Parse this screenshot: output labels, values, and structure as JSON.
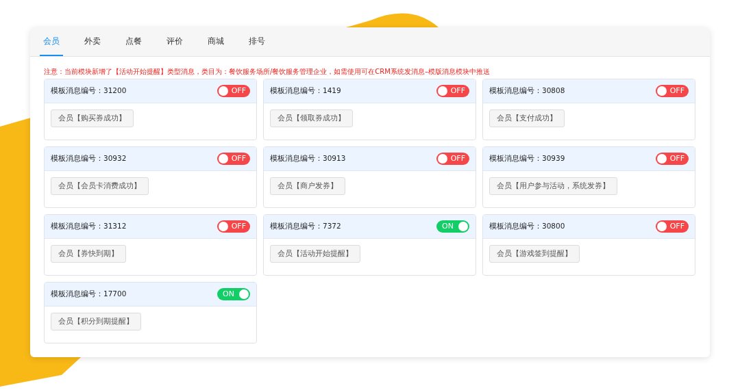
{
  "tabs": [
    {
      "label": "会员",
      "selected": true
    },
    {
      "label": "外卖",
      "selected": false
    },
    {
      "label": "点餐",
      "selected": false
    },
    {
      "label": "评价",
      "selected": false
    },
    {
      "label": "商城",
      "selected": false
    },
    {
      "label": "排号",
      "selected": false
    }
  ],
  "notice": "注意：当前模块新增了【活动开始提醒】类型消息，类目为：餐饮服务场所/餐饮服务管理企业，如需使用可在CRM系统发消息–模版消息模块中推送",
  "templates": [
    {
      "title": "模板消息编号：31200",
      "on": false,
      "toggle_label": "OFF",
      "button": "会员【购买券成功】"
    },
    {
      "title": "模板消息编号：1419",
      "on": false,
      "toggle_label": "OFF",
      "button": "会员【领取券成功】"
    },
    {
      "title": "模板消息编号：30808",
      "on": false,
      "toggle_label": "OFF",
      "button": "会员【支付成功】"
    },
    {
      "title": "模板消息编号：30932",
      "on": false,
      "toggle_label": "OFF",
      "button": "会员【会员卡消费成功】"
    },
    {
      "title": "模板消息编号：30913",
      "on": false,
      "toggle_label": "OFF",
      "button": "会员【商户发券】"
    },
    {
      "title": "模板消息编号：30939",
      "on": false,
      "toggle_label": "OFF",
      "button": "会员【用户参与活动，系统发券】"
    },
    {
      "title": "模板消息编号：31312",
      "on": false,
      "toggle_label": "OFF",
      "button": "会员【券快到期】"
    },
    {
      "title": "模板消息编号：7372",
      "on": true,
      "toggle_label": "ON",
      "button": "会员【活动开始提醒】"
    },
    {
      "title": "模板消息编号：30800",
      "on": false,
      "toggle_label": "OFF",
      "button": "会员【游戏签到提醒】"
    },
    {
      "title": "模板消息编号：17700",
      "on": true,
      "toggle_label": "ON",
      "button": "会员【积分到期提醒】"
    }
  ]
}
